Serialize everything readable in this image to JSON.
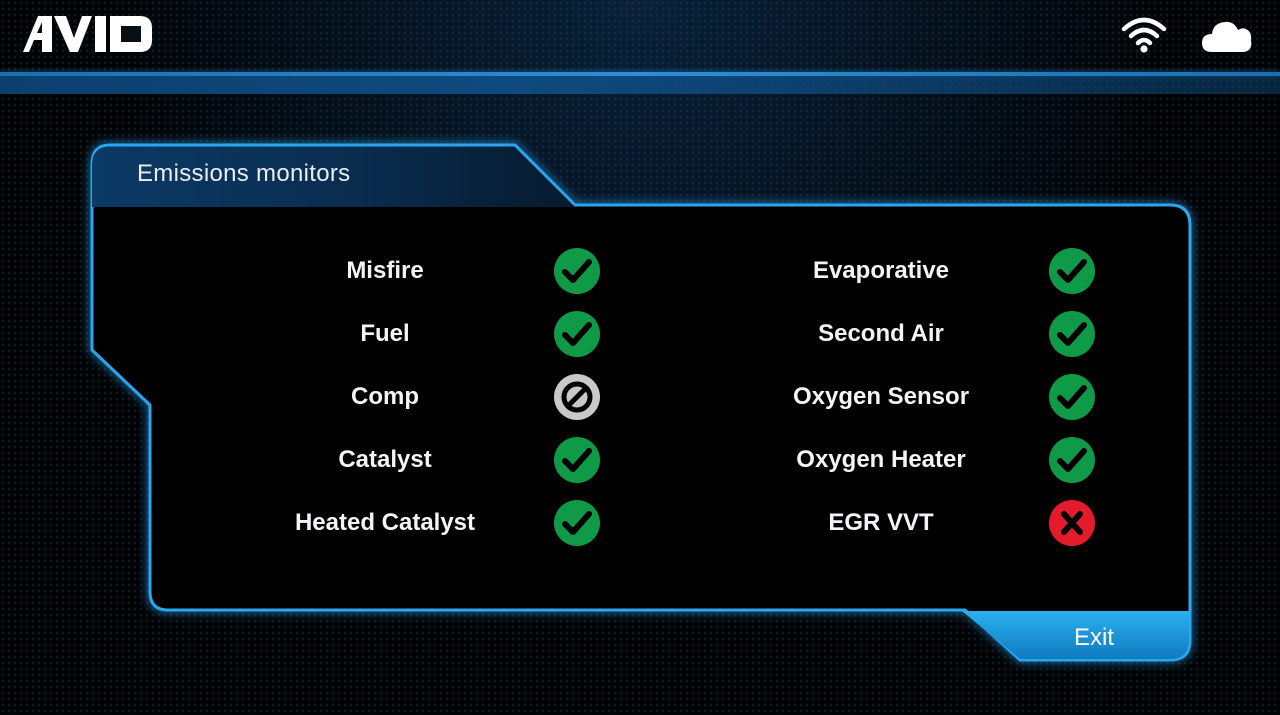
{
  "header": {
    "logo_text": "AVID",
    "wifi_icon": "wifi-icon",
    "cloud_icon": "cloud-icon"
  },
  "panel": {
    "title": "Emissions monitors",
    "exit_label": "Exit"
  },
  "colors": {
    "accent": "#2aa6f0",
    "ok": "#0f9a47",
    "na": "#c9c9c9",
    "fail": "#e31b2b"
  },
  "monitors": {
    "left": [
      {
        "label": "Misfire",
        "status": "ok"
      },
      {
        "label": "Fuel",
        "status": "ok"
      },
      {
        "label": "Comp",
        "status": "not-supported"
      },
      {
        "label": "Catalyst",
        "status": "ok"
      },
      {
        "label": "Heated Catalyst",
        "status": "ok"
      }
    ],
    "right": [
      {
        "label": "Evaporative",
        "status": "ok"
      },
      {
        "label": "Second Air",
        "status": "ok"
      },
      {
        "label": "Oxygen Sensor",
        "status": "ok"
      },
      {
        "label": "Oxygen Heater",
        "status": "ok"
      },
      {
        "label": "EGR VVT",
        "status": "fail"
      }
    ]
  }
}
